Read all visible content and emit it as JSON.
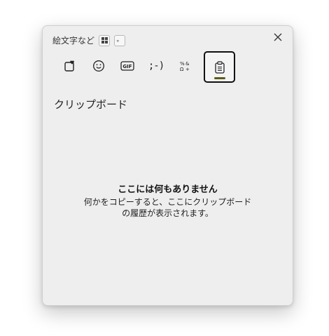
{
  "header": {
    "title": "絵文字など",
    "mini_button2": "。"
  },
  "tabs": [
    {
      "name": "favorites",
      "icon": "heart-tag-icon"
    },
    {
      "name": "emoji",
      "icon": "smiley-icon"
    },
    {
      "name": "gif",
      "icon": "gif-icon",
      "label": "GIF"
    },
    {
      "name": "kaomoji",
      "icon": "kaomoji-icon",
      "label": ";-)"
    },
    {
      "name": "symbols",
      "icon": "symbols-icon",
      "label": "%&Ω+"
    },
    {
      "name": "clipboard",
      "icon": "clipboard-icon",
      "active": true
    }
  ],
  "section": {
    "title": "クリップボード"
  },
  "empty": {
    "heading": "ここには何もありません",
    "line1": "何かをコピーすると、ここにクリップボード",
    "line2": "の履歴が表示されます。"
  },
  "colors": {
    "accent": "#5c5c19",
    "panel_bg": "#eeeeee"
  }
}
